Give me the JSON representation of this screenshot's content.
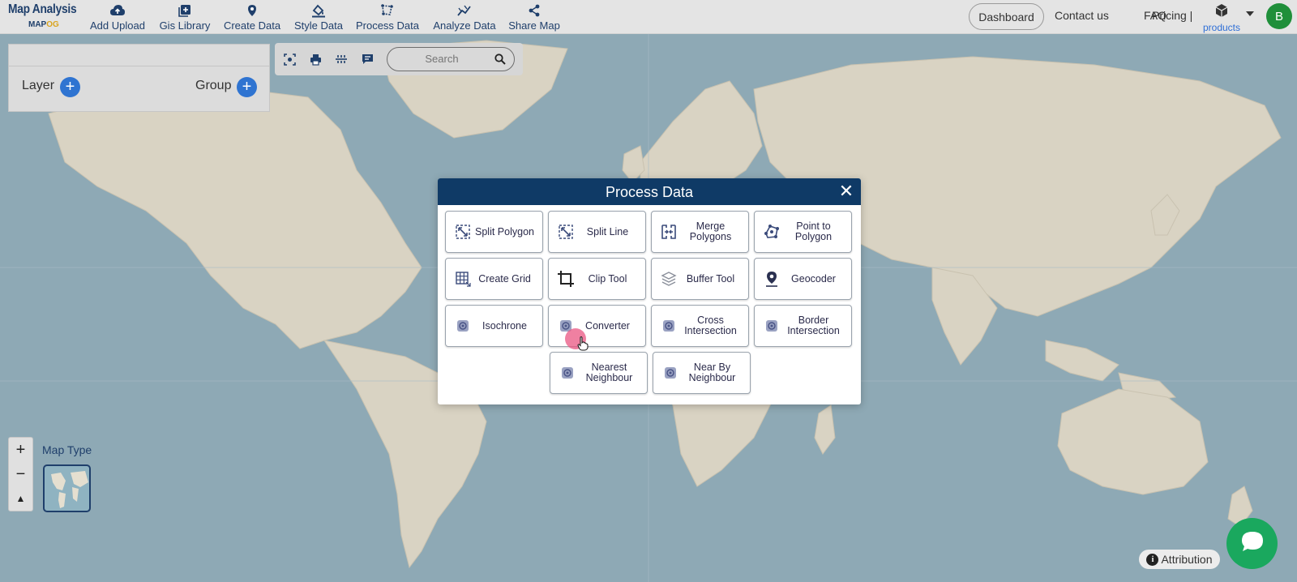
{
  "brand": {
    "title": "Map Analysis",
    "sub_prefix": "MAP",
    "sub_suffix": "OG"
  },
  "nav": {
    "items": [
      {
        "label": "Add Upload",
        "icon": "cloud-upload-icon"
      },
      {
        "label": "Gis Library",
        "icon": "library-add-icon"
      },
      {
        "label": "Create Data",
        "icon": "map-pin-icon"
      },
      {
        "label": "Style Data",
        "icon": "paint-bucket-icon"
      },
      {
        "label": "Process Data",
        "icon": "polygon-edit-icon"
      },
      {
        "label": "Analyze Data",
        "icon": "chart-line-icon"
      },
      {
        "label": "Share Map",
        "icon": "share-icon"
      }
    ],
    "dashboard": "Dashboard",
    "contact": "Contact us",
    "faq": "FAQ",
    "pricing": "Pricing |",
    "products": "products",
    "avatar_initial": "B"
  },
  "layer_panel": {
    "layer_label": "Layer",
    "group_label": "Group"
  },
  "toolbar": {
    "search_placeholder": "Search"
  },
  "dialog": {
    "title": "Process Data",
    "tools": [
      {
        "label": "Split Polygon",
        "icon": "split-polygon-icon"
      },
      {
        "label": "Split Line",
        "icon": "split-line-icon"
      },
      {
        "label": "Merge Polygons",
        "icon": "merge-icon"
      },
      {
        "label": "Point to Polygon",
        "icon": "point-to-polygon-icon"
      },
      {
        "label": "Create Grid",
        "icon": "grid-icon"
      },
      {
        "label": "Clip Tool",
        "icon": "crop-icon"
      },
      {
        "label": "Buffer Tool",
        "icon": "layers-icon"
      },
      {
        "label": "Geocoder",
        "icon": "location-pin-icon"
      },
      {
        "label": "Isochrone",
        "icon": "isochrone-icon"
      },
      {
        "label": "Converter",
        "icon": "converter-icon"
      },
      {
        "label": "Cross Intersection",
        "icon": "cross-intersection-icon"
      },
      {
        "label": "Border Intersection",
        "icon": "border-intersection-icon"
      },
      {
        "label": "Nearest Neighbour",
        "icon": "nearest-neighbour-icon"
      },
      {
        "label": "Near By Neighbour",
        "icon": "nearby-neighbour-icon"
      }
    ]
  },
  "map": {
    "map_type_label": "Map Type",
    "attribution": "Attribution"
  }
}
